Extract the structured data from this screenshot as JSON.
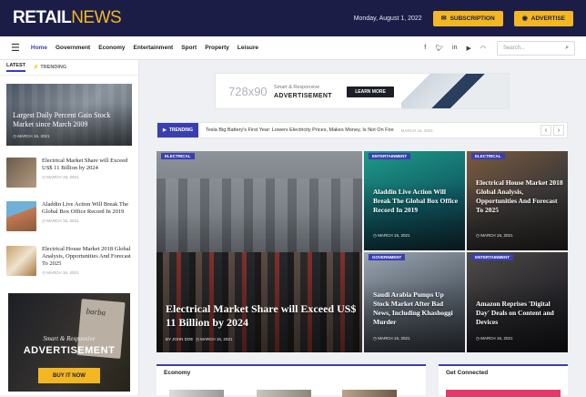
{
  "header": {
    "logo_bold": "RETAIL",
    "logo_light": "NEWS",
    "date": "Monday, August 1, 2022",
    "subscription_label": "SUBSCRIPTION",
    "advertise_label": "ADVERTISE"
  },
  "nav": {
    "items": [
      "Home",
      "Government",
      "Economy",
      "Entertainment",
      "Sport",
      "Property",
      "Leisure"
    ],
    "search_placeholder": "Search..."
  },
  "sidebar": {
    "tabs": [
      "LATEST",
      "TRENDING"
    ],
    "featured": {
      "title": "Largest Daily Percent Gain Stock Market since March 2009",
      "meta": "MARCH 16, 2021"
    },
    "items": [
      {
        "title": "Electrical Market Share will Exceed US$ 11 Billion by 2024",
        "meta": "MARCH 16, 2021"
      },
      {
        "title": "Aladdin Live Action Will Break The Global Box Office Record In 2019",
        "meta": "MARCH 16, 2021"
      },
      {
        "title": "Electrical House Market 2018 Global Analysis, Opportunities And Forecast To 2025",
        "meta": "MARCH 16, 2021"
      }
    ],
    "ad": {
      "line1": "Smart & Responsive",
      "line2": "ADVERTISEMENT",
      "button": "BUY IT NOW",
      "mag": "barba"
    }
  },
  "top_ad": {
    "size": "728x90",
    "line1": "Smart & Responsive",
    "line2": "ADVERTISEMENT",
    "button": "LEARN MORE"
  },
  "ticker": {
    "label": "TRENDING",
    "text": "Tesla Big Battery's First Year: Lowers Electricity Prices, Makes Money, Is Not On Fire",
    "date": "MARCH 16, 2021"
  },
  "grid": {
    "main": {
      "category": "ELECTRICAL",
      "title": "Electrical Market Share will Exceed US$ 11 Billion by 2024",
      "author": "BY JOHN DOE",
      "date": "MARCH 16, 2021"
    },
    "cards": [
      {
        "category": "ENTERTAINMENT",
        "title": "Aladdin Live Action Will Break The Global Box Office Record In 2019",
        "date": "MARCH 16, 2021"
      },
      {
        "category": "ELECTRICAL",
        "title": "Electrical House Market 2018 Global Analysis, Opportunities And Forecast To 2025",
        "date": "MARCH 16, 2021"
      },
      {
        "category": "GOVERNMENT",
        "title": "Saudi Arabia Pumps Up Stock Market After Bad News, Including Khashoggi Murder",
        "date": "MARCH 16, 2021"
      },
      {
        "category": "ENTERTAINMENT",
        "title": "Amazon Reprises 'Digital Day' Deals on Content and Devices",
        "date": "MARCH 16, 2021"
      }
    ]
  },
  "sections": {
    "economy": "Economy",
    "connected": "Get Connected"
  },
  "colors": {
    "navy": "#1b1d47",
    "accent": "#f2b722",
    "brand_blue": "#3a3fb0"
  }
}
